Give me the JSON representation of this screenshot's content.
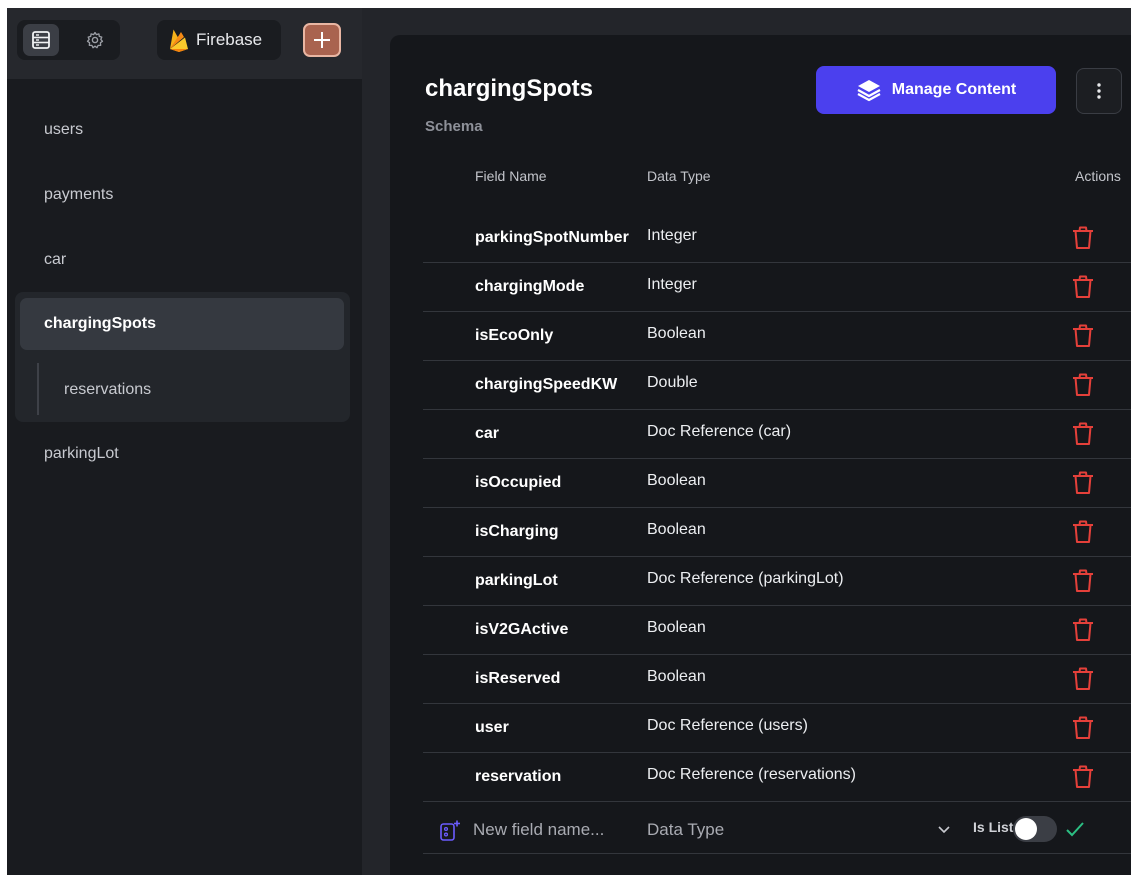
{
  "topbar": {
    "firebase_label": "Firebase"
  },
  "sidebar": {
    "items": [
      {
        "label": "users"
      },
      {
        "label": "payments"
      },
      {
        "label": "car"
      },
      {
        "label": "chargingSpots"
      },
      {
        "label": "reservations"
      },
      {
        "label": "parkingLot"
      }
    ]
  },
  "main": {
    "title": "chargingSpots",
    "subtitle": "Schema",
    "manage_label": "Manage Content",
    "columns": {
      "field": "Field Name",
      "type": "Data Type",
      "actions": "Actions"
    },
    "fields": [
      {
        "name": "parkingSpotNumber",
        "type": "Integer"
      },
      {
        "name": "chargingMode",
        "type": "Integer"
      },
      {
        "name": "isEcoOnly",
        "type": "Boolean"
      },
      {
        "name": "chargingSpeedKW",
        "type": "Double"
      },
      {
        "name": "car",
        "type": "Doc Reference (car)"
      },
      {
        "name": "isOccupied",
        "type": "Boolean"
      },
      {
        "name": "isCharging",
        "type": "Boolean"
      },
      {
        "name": "parkingLot",
        "type": "Doc Reference (parkingLot)"
      },
      {
        "name": "isV2GActive",
        "type": "Boolean"
      },
      {
        "name": "isReserved",
        "type": "Boolean"
      },
      {
        "name": "user",
        "type": "Doc Reference (users)"
      },
      {
        "name": "reservation",
        "type": "Doc Reference (reservations)"
      }
    ],
    "new_field": {
      "placeholder": "New field name...",
      "type_placeholder": "Data Type",
      "is_list_label": "Is List"
    }
  },
  "colors": {
    "accent": "#4b40ee",
    "delete": "#e5403a",
    "check": "#2bbf83",
    "add": "#a9634f"
  }
}
